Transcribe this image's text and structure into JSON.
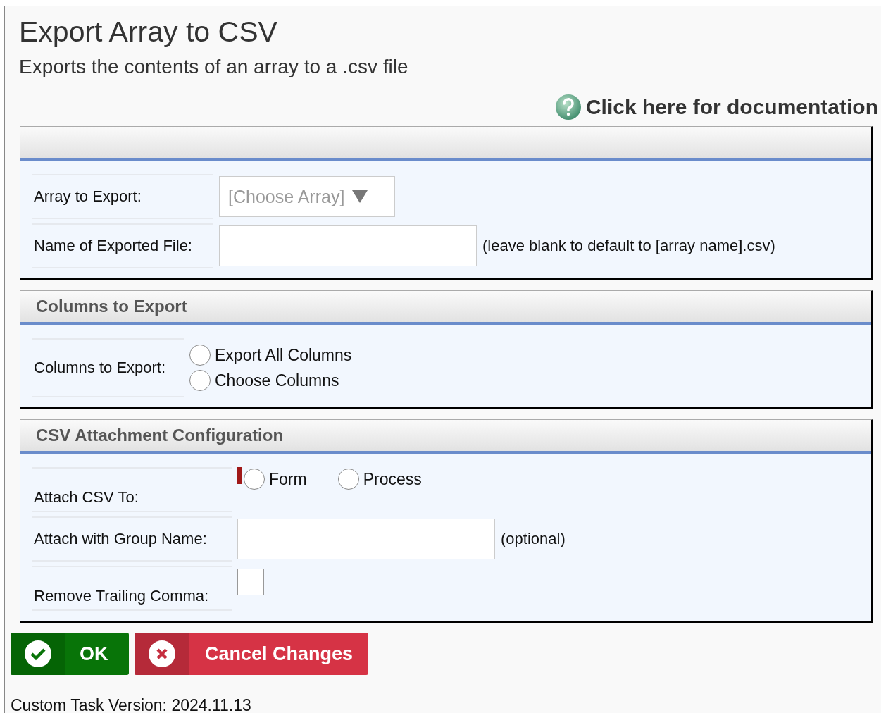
{
  "title": "Export Array to CSV",
  "subtitle": "Exports the contents of an array to a .csv file",
  "doc_link": "Click here for documentation",
  "sections": [
    {
      "rows": [
        {
          "kind": "select",
          "label": "Array to Export:",
          "placeholder": "[Choose Array]"
        },
        {
          "kind": "text",
          "label": "Name of Exported File:",
          "hint": "(leave blank to default to [array name].csv)"
        }
      ]
    },
    {
      "heading": "Columns to Export",
      "rows": [
        {
          "kind": "radio-stack",
          "label": "Columns to Export:",
          "options": [
            {
              "label": "Export All Columns",
              "selected": false
            },
            {
              "label": "Choose Columns",
              "selected": false
            }
          ]
        }
      ]
    },
    {
      "heading": "CSV Attachment Configuration",
      "rows": [
        {
          "kind": "radio-inline",
          "label": "Attach CSV To:",
          "required": true,
          "options": [
            {
              "label": "Form",
              "selected": false
            },
            {
              "label": "Process",
              "selected": false
            }
          ]
        },
        {
          "kind": "text",
          "label": "Attach with Group Name:",
          "hint": "(optional)"
        },
        {
          "kind": "checkbox",
          "label": "Remove Trailing Comma:",
          "checked": false
        }
      ]
    }
  ],
  "buttons": [
    {
      "kind": "ok",
      "label": "OK"
    },
    {
      "kind": "cancel",
      "label": "Cancel Changes"
    }
  ],
  "version": "Custom Task Version: 2024.11.13"
}
